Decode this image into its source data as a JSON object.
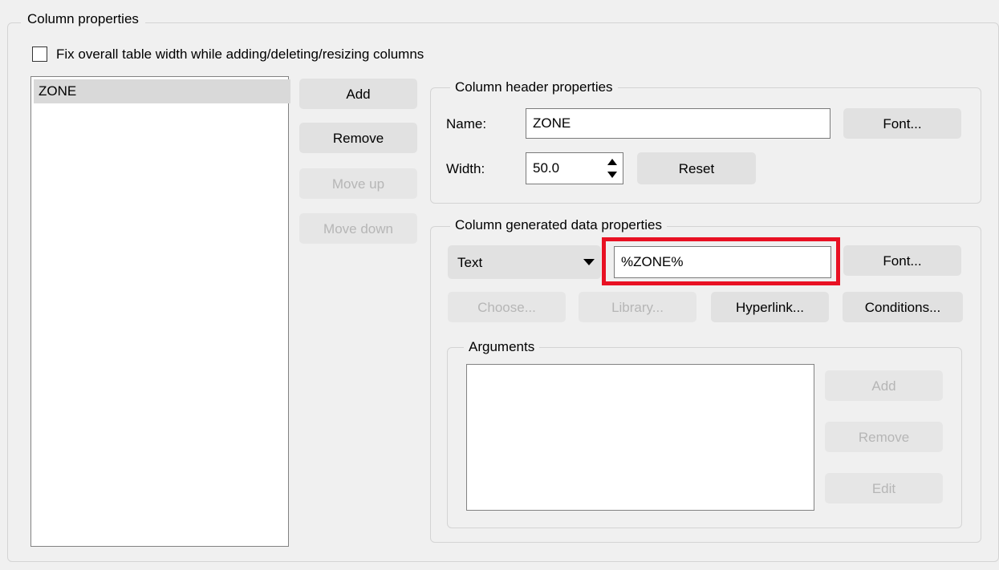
{
  "column_properties": {
    "title": "Column properties",
    "fix_width_label": "Fix overall table width while adding/deleting/resizing columns",
    "fix_width_checked": false,
    "columns": [
      "ZONE"
    ],
    "buttons": {
      "add": "Add",
      "remove": "Remove",
      "move_up": "Move up",
      "move_down": "Move down"
    }
  },
  "header_properties": {
    "title": "Column header properties",
    "name_label": "Name:",
    "name_value": "ZONE",
    "font_button": "Font...",
    "width_label": "Width:",
    "width_value": "50.0",
    "reset_button": "Reset"
  },
  "generated_data": {
    "title": "Column generated data properties",
    "type_value": "Text",
    "expression_value": "%ZONE%",
    "font_button": "Font...",
    "choose_button": "Choose...",
    "library_button": "Library...",
    "hyperlink_button": "Hyperlink...",
    "conditions_button": "Conditions...",
    "highlight_color": "#e81123"
  },
  "arguments": {
    "title": "Arguments",
    "add_button": "Add",
    "remove_button": "Remove",
    "edit_button": "Edit"
  }
}
